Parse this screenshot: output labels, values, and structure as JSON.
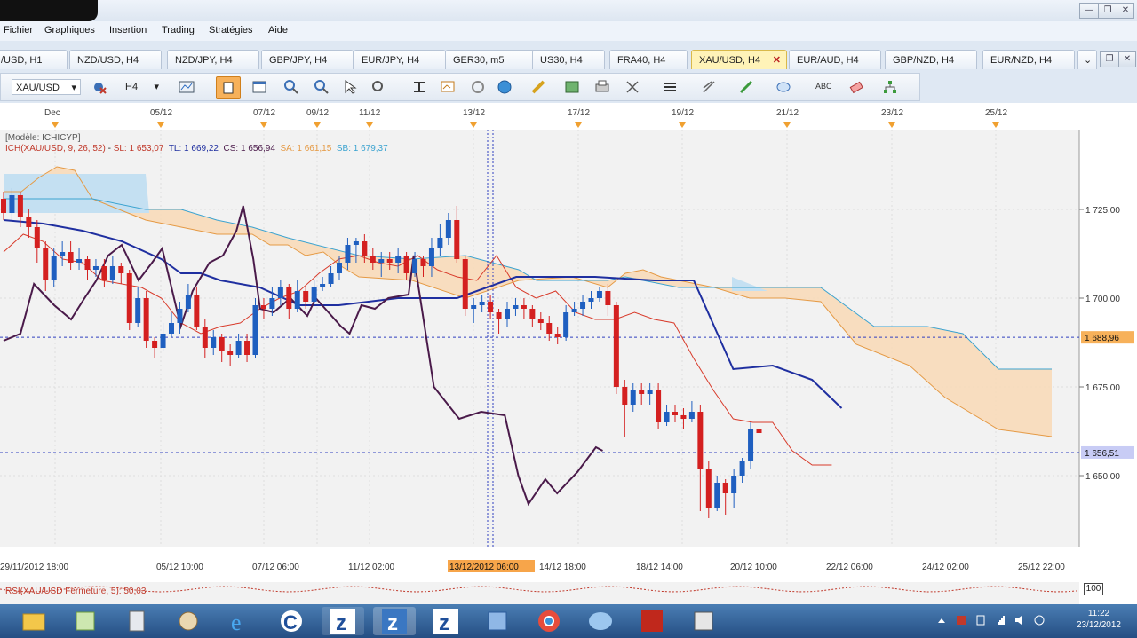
{
  "menu": [
    "Fichier",
    "Graphiques",
    "Insertion",
    "Trading",
    "Stratégies",
    "Aide"
  ],
  "tabs": [
    {
      "label": "/USD, H1"
    },
    {
      "label": "NZD/USD, H4"
    },
    {
      "label": "NZD/JPY, H4"
    },
    {
      "label": "GBP/JPY, H4"
    },
    {
      "label": "EUR/JPY, H4"
    },
    {
      "label": "GER30, m5"
    },
    {
      "label": "US30, H4"
    },
    {
      "label": "FRA40, H4"
    },
    {
      "label": "XAU/USD, H4",
      "active": true
    },
    {
      "label": "EUR/AUD, H4"
    },
    {
      "label": "GBP/NZD, H4"
    },
    {
      "label": "EUR/NZD, H4"
    }
  ],
  "toolbar": {
    "symbol": "XAU/USD",
    "timeframe": "H4"
  },
  "chart": {
    "top_dates": [
      "Dec",
      "05/12",
      "07/12",
      "09/12",
      "11/12",
      "13/12",
      "17/12",
      "19/12",
      "21/12",
      "23/12",
      "25/12"
    ],
    "legend_model": "[Modèle: ICHICYP]",
    "legend_ich": "ICH(XAU/USD, 9, 26, 52)",
    "legend_sl": "SL: 1 653,07",
    "legend_tl": "TL: 1 669,22",
    "legend_cs": "CS: 1 656,94",
    "legend_sa": "SA: 1 661,15",
    "legend_sb": "SB: 1 679,37",
    "price_labels": [
      "1 725,00",
      "1 700,00",
      "1 675,00",
      "1 650,00"
    ],
    "marker_1": "1 688,96",
    "marker_2": "1 656,51",
    "bottom_dates": [
      "29/11/2012 18:00",
      "05/12 10:00",
      "07/12 06:00",
      "11/12 02:00",
      "13/12/2012 06:00",
      "14/12 18:00",
      "18/12 14:00",
      "20/12 10:00",
      "22/12 06:00",
      "24/12 02:00",
      "25/12 22:00"
    ],
    "rsi_label": "RSI(XAU/USD Fermeture, 5): 50,03",
    "rsi_scale": "100"
  },
  "chart_data": {
    "type": "line",
    "y_ticks": [
      1725,
      1700,
      1675,
      1650
    ],
    "markers": [
      1688.96,
      1656.51
    ],
    "values": {
      "SL": 1653.07,
      "TL": 1669.22,
      "CS": 1656.94,
      "SA": 1661.15,
      "SB": 1679.37
    },
    "candles": [
      [
        1728,
        1724,
        1730,
        1722
      ],
      [
        1724,
        1729,
        1731,
        1722
      ],
      [
        1729,
        1723,
        1730,
        1720
      ],
      [
        1723,
        1720,
        1725,
        1717
      ],
      [
        1720,
        1714,
        1722,
        1710
      ],
      [
        1714,
        1705,
        1716,
        1702
      ],
      [
        1705,
        1712,
        1714,
        1703
      ],
      [
        1712,
        1713,
        1716,
        1709
      ],
      [
        1713,
        1710,
        1716,
        1708
      ],
      [
        1710,
        1711,
        1714,
        1708
      ],
      [
        1711,
        1708,
        1712,
        1705
      ],
      [
        1708,
        1709,
        1711,
        1706
      ],
      [
        1709,
        1705,
        1711,
        1703
      ],
      [
        1705,
        1709,
        1712,
        1704
      ],
      [
        1709,
        1707,
        1710,
        1704
      ],
      [
        1707,
        1693,
        1708,
        1691
      ],
      [
        1693,
        1700,
        1703,
        1692
      ],
      [
        1700,
        1688,
        1702,
        1686
      ],
      [
        1688,
        1686,
        1689,
        1683
      ],
      [
        1686,
        1690,
        1693,
        1685
      ],
      [
        1690,
        1693,
        1696,
        1689
      ],
      [
        1693,
        1697,
        1699,
        1690
      ],
      [
        1697,
        1701,
        1704,
        1696
      ],
      [
        1701,
        1692,
        1703,
        1691
      ],
      [
        1692,
        1686,
        1694,
        1683
      ],
      [
        1686,
        1689,
        1691,
        1684
      ],
      [
        1689,
        1685,
        1690,
        1682
      ],
      [
        1685,
        1684,
        1687,
        1681
      ],
      [
        1684,
        1688,
        1690,
        1683
      ],
      [
        1688,
        1684,
        1690,
        1682
      ],
      [
        1684,
        1698,
        1700,
        1683
      ],
      [
        1698,
        1697,
        1700,
        1694
      ],
      [
        1697,
        1700,
        1703,
        1695
      ],
      [
        1700,
        1703,
        1705,
        1698
      ],
      [
        1703,
        1697,
        1704,
        1694
      ],
      [
        1697,
        1702,
        1705,
        1696
      ],
      [
        1702,
        1699,
        1703,
        1697
      ],
      [
        1699,
        1703,
        1705,
        1698
      ],
      [
        1703,
        1704,
        1706,
        1702
      ],
      [
        1704,
        1707,
        1709,
        1703
      ],
      [
        1707,
        1710,
        1712,
        1705
      ],
      [
        1710,
        1715,
        1717,
        1708
      ],
      [
        1715,
        1716,
        1717,
        1710
      ],
      [
        1716,
        1712,
        1718,
        1710
      ],
      [
        1712,
        1710,
        1714,
        1708
      ],
      [
        1710,
        1711,
        1713,
        1706
      ],
      [
        1711,
        1710,
        1713,
        1708
      ],
      [
        1710,
        1712,
        1714,
        1707
      ],
      [
        1712,
        1707,
        1713,
        1705
      ],
      [
        1707,
        1711,
        1713,
        1706
      ],
      [
        1711,
        1709,
        1712,
        1706
      ],
      [
        1709,
        1714,
        1717,
        1706
      ],
      [
        1714,
        1717,
        1721,
        1712
      ],
      [
        1717,
        1722,
        1724,
        1715
      ],
      [
        1722,
        1711,
        1726,
        1710
      ],
      [
        1711,
        1697,
        1712,
        1695
      ],
      [
        1697,
        1698,
        1700,
        1693
      ],
      [
        1698,
        1699,
        1701,
        1696
      ],
      [
        1699,
        1696,
        1701,
        1694
      ],
      [
        1696,
        1694,
        1697,
        1690
      ],
      [
        1694,
        1697,
        1699,
        1692
      ],
      [
        1697,
        1698,
        1700,
        1695
      ],
      [
        1698,
        1697,
        1700,
        1694
      ],
      [
        1697,
        1694,
        1698,
        1692
      ],
      [
        1694,
        1693,
        1696,
        1691
      ],
      [
        1693,
        1690,
        1695,
        1688
      ],
      [
        1690,
        1689,
        1692,
        1687
      ],
      [
        1689,
        1696,
        1698,
        1688
      ],
      [
        1696,
        1697,
        1699,
        1695
      ],
      [
        1697,
        1699,
        1701,
        1695
      ],
      [
        1699,
        1700,
        1702,
        1697
      ],
      [
        1700,
        1702,
        1703,
        1699
      ],
      [
        1702,
        1698,
        1704,
        1695
      ],
      [
        1698,
        1675,
        1699,
        1673
      ],
      [
        1675,
        1670,
        1677,
        1661
      ],
      [
        1670,
        1674,
        1676,
        1668
      ],
      [
        1674,
        1673,
        1676,
        1670
      ],
      [
        1673,
        1674,
        1676,
        1670
      ],
      [
        1674,
        1665,
        1676,
        1663
      ],
      [
        1665,
        1668,
        1670,
        1664
      ],
      [
        1668,
        1667,
        1670,
        1665
      ],
      [
        1667,
        1666,
        1669,
        1663
      ],
      [
        1666,
        1668,
        1671,
        1665
      ],
      [
        1668,
        1652,
        1670,
        1640
      ],
      [
        1652,
        1641,
        1654,
        1638
      ],
      [
        1641,
        1648,
        1650,
        1640
      ],
      [
        1648,
        1645,
        1649,
        1639
      ],
      [
        1645,
        1650,
        1652,
        1641
      ],
      [
        1650,
        1654,
        1655,
        1648
      ],
      [
        1654,
        1663,
        1665,
        1652
      ],
      [
        1663,
        1662,
        1665,
        1658
      ]
    ],
    "chikou": [
      [
        0,
        1688
      ],
      [
        10,
        1690
      ],
      [
        18,
        1704
      ],
      [
        30,
        1698
      ],
      [
        40,
        1694
      ],
      [
        48,
        1700
      ],
      [
        55,
        1705
      ],
      [
        62,
        1712
      ],
      [
        70,
        1715
      ],
      [
        75,
        1710
      ],
      [
        80,
        1705
      ],
      [
        88,
        1710
      ],
      [
        94,
        1714
      ],
      [
        98,
        1706
      ],
      [
        105,
        1692
      ],
      [
        112,
        1702
      ],
      [
        122,
        1710
      ],
      [
        130,
        1712
      ],
      [
        138,
        1719
      ],
      [
        142,
        1726
      ],
      [
        148,
        1711
      ],
      [
        152,
        1697
      ],
      [
        160,
        1696
      ],
      [
        170,
        1700
      ],
      [
        180,
        1695
      ],
      [
        185,
        1700
      ],
      [
        200,
        1692
      ],
      [
        205,
        1690
      ],
      [
        212,
        1698
      ],
      [
        220,
        1697
      ],
      [
        228,
        1700
      ],
      [
        240,
        1701
      ],
      [
        243,
        1712
      ],
      [
        255,
        1675
      ],
      [
        270,
        1666
      ],
      [
        283,
        1668
      ],
      [
        297,
        1667
      ],
      [
        305,
        1650
      ],
      [
        311,
        1642
      ],
      [
        321,
        1649
      ],
      [
        328,
        1645
      ],
      [
        340,
        1651
      ],
      [
        351,
        1658
      ],
      [
        355,
        1657
      ]
    ],
    "tenkan": [
      [
        0,
        1713
      ],
      [
        10,
        1718
      ],
      [
        20,
        1716
      ],
      [
        30,
        1711
      ],
      [
        40,
        1710
      ],
      [
        50,
        1705
      ],
      [
        60,
        1704
      ],
      [
        70,
        1703
      ],
      [
        80,
        1700
      ],
      [
        90,
        1693
      ],
      [
        100,
        1690
      ],
      [
        110,
        1692
      ],
      [
        120,
        1693
      ],
      [
        130,
        1697
      ],
      [
        140,
        1700
      ],
      [
        150,
        1702
      ],
      [
        160,
        1707
      ],
      [
        170,
        1711
      ],
      [
        180,
        1712
      ],
      [
        190,
        1710
      ],
      [
        200,
        1709
      ],
      [
        210,
        1712
      ],
      [
        220,
        1708
      ],
      [
        230,
        1706
      ],
      [
        240,
        1705
      ],
      [
        250,
        1712
      ],
      [
        260,
        1703
      ],
      [
        270,
        1700
      ],
      [
        280,
        1702
      ],
      [
        290,
        1696
      ],
      [
        300,
        1694
      ],
      [
        310,
        1694
      ],
      [
        320,
        1696
      ],
      [
        330,
        1694
      ],
      [
        340,
        1693
      ],
      [
        350,
        1683
      ],
      [
        360,
        1674
      ],
      [
        370,
        1666
      ],
      [
        380,
        1665
      ],
      [
        390,
        1665
      ],
      [
        400,
        1657
      ],
      [
        410,
        1653
      ],
      [
        420,
        1653
      ]
    ],
    "kijun": [
      [
        0,
        1722
      ],
      [
        20,
        1721
      ],
      [
        40,
        1719
      ],
      [
        60,
        1716
      ],
      [
        80,
        1711
      ],
      [
        90,
        1707
      ],
      [
        100,
        1707
      ],
      [
        110,
        1705
      ],
      [
        130,
        1703
      ],
      [
        150,
        1698
      ],
      [
        170,
        1698
      ],
      [
        200,
        1700
      ],
      [
        230,
        1700
      ],
      [
        260,
        1706
      ],
      [
        300,
        1706
      ],
      [
        330,
        1705
      ],
      [
        350,
        1705
      ],
      [
        370,
        1680
      ],
      [
        390,
        1681
      ],
      [
        410,
        1677
      ],
      [
        425,
        1669
      ]
    ],
    "senkouA": [
      [
        0,
        1730
      ],
      [
        10,
        1730
      ],
      [
        20,
        1734
      ],
      [
        30,
        1737
      ],
      [
        40,
        1736
      ],
      [
        50,
        1728
      ],
      [
        60,
        1726
      ],
      [
        70,
        1724
      ],
      [
        80,
        1722
      ],
      [
        100,
        1720
      ],
      [
        120,
        1718
      ],
      [
        140,
        1718
      ],
      [
        150,
        1715
      ],
      [
        160,
        1715
      ],
      [
        170,
        1712
      ],
      [
        180,
        1713
      ],
      [
        190,
        1709
      ],
      [
        200,
        1706
      ],
      [
        230,
        1705
      ],
      [
        260,
        1700
      ],
      [
        290,
        1705
      ],
      [
        320,
        1706
      ],
      [
        340,
        1703
      ],
      [
        350,
        1707
      ],
      [
        360,
        1708
      ],
      [
        370,
        1706
      ],
      [
        380,
        1705
      ],
      [
        400,
        1703
      ],
      [
        420,
        1700
      ],
      [
        440,
        1700
      ],
      [
        460,
        1699
      ],
      [
        480,
        1687
      ],
      [
        510,
        1681
      ],
      [
        530,
        1672
      ],
      [
        560,
        1663
      ],
      [
        590,
        1661
      ]
    ],
    "senkouB": [
      [
        0,
        1728
      ],
      [
        50,
        1728
      ],
      [
        80,
        1725
      ],
      [
        100,
        1725
      ],
      [
        120,
        1722
      ],
      [
        140,
        1720
      ],
      [
        160,
        1717
      ],
      [
        200,
        1712
      ],
      [
        230,
        1711
      ],
      [
        260,
        1712
      ],
      [
        290,
        1708
      ],
      [
        300,
        1705
      ],
      [
        340,
        1705
      ],
      [
        350,
        1706
      ],
      [
        360,
        1705
      ],
      [
        380,
        1703
      ],
      [
        420,
        1703
      ],
      [
        440,
        1703
      ],
      [
        460,
        1703
      ],
      [
        490,
        1692
      ],
      [
        520,
        1692
      ],
      [
        540,
        1690
      ],
      [
        560,
        1680
      ],
      [
        590,
        1680
      ]
    ]
  }
}
